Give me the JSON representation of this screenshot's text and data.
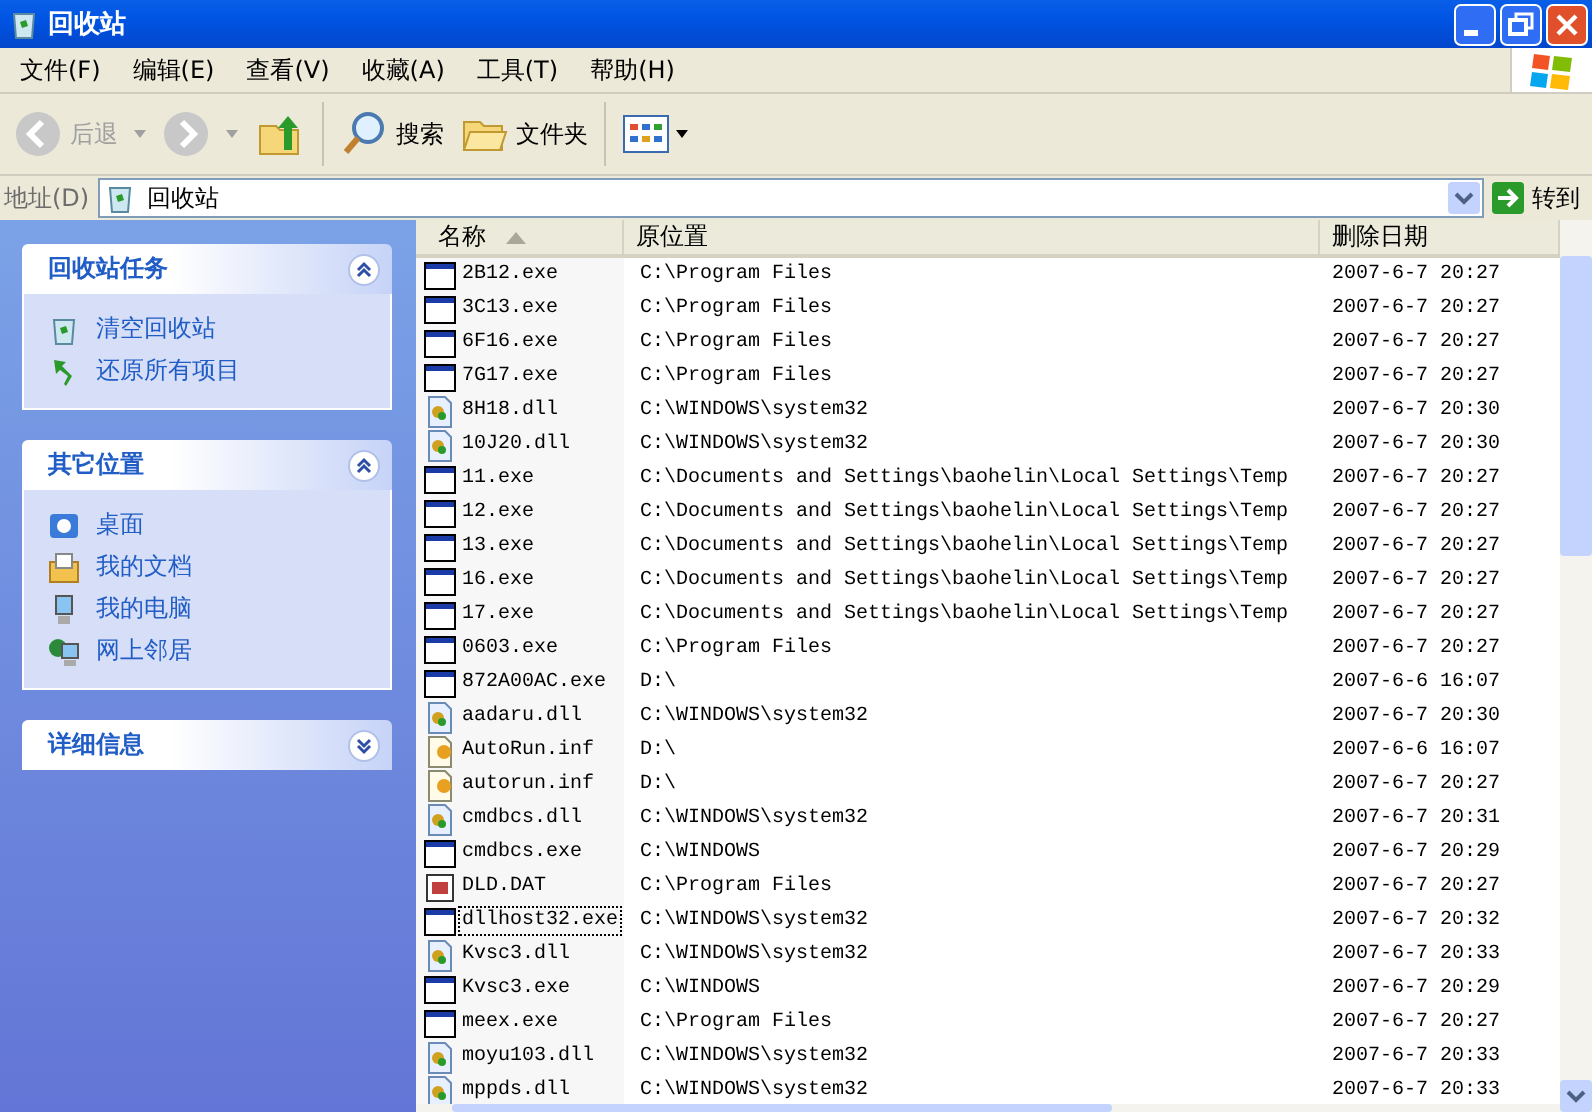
{
  "window": {
    "title": "回收站"
  },
  "menu": [
    "文件(F)",
    "编辑(E)",
    "查看(V)",
    "收藏(A)",
    "工具(T)",
    "帮助(H)"
  ],
  "toolbar": {
    "back": {
      "label": "后退",
      "disabled": true
    },
    "forward": {
      "disabled": true
    },
    "search": "搜索",
    "folders": "文件夹"
  },
  "address": {
    "label": "地址(D)",
    "value": "回收站",
    "go": "转到"
  },
  "task_panes": [
    {
      "title": "回收站任务",
      "expanded": true,
      "items": [
        {
          "label": "清空回收站",
          "kind": "bin"
        },
        {
          "label": "还原所有项目",
          "kind": "restore"
        }
      ]
    },
    {
      "title": "其它位置",
      "expanded": true,
      "items": [
        {
          "label": "桌面",
          "kind": "desktop"
        },
        {
          "label": "我的文档",
          "kind": "documents"
        },
        {
          "label": "我的电脑",
          "kind": "computer"
        },
        {
          "label": "网上邻居",
          "kind": "network"
        }
      ]
    },
    {
      "title": "详细信息",
      "expanded": false
    }
  ],
  "table": {
    "columns": [
      "名称",
      "原位置",
      "删除日期"
    ],
    "rows": [
      {
        "name": "2B12.exe",
        "location": "C:\\Program Files",
        "date": "2007-6-7 20:27",
        "kind": "exe",
        "focused": false
      },
      {
        "name": "3C13.exe",
        "location": "C:\\Program Files",
        "date": "2007-6-7 20:27",
        "kind": "exe",
        "focused": false
      },
      {
        "name": "6F16.exe",
        "location": "C:\\Program Files",
        "date": "2007-6-7 20:27",
        "kind": "exe",
        "focused": false
      },
      {
        "name": "7G17.exe",
        "location": "C:\\Program Files",
        "date": "2007-6-7 20:27",
        "kind": "exe",
        "focused": false
      },
      {
        "name": "8H18.dll",
        "location": "C:\\WINDOWS\\system32",
        "date": "2007-6-7 20:30",
        "kind": "dll",
        "focused": false
      },
      {
        "name": "10J20.dll",
        "location": "C:\\WINDOWS\\system32",
        "date": "2007-6-7 20:30",
        "kind": "dll",
        "focused": false
      },
      {
        "name": "11.exe",
        "location": "C:\\Documents and Settings\\baohelin\\Local Settings\\Temp",
        "date": "2007-6-7 20:27",
        "kind": "exe",
        "focused": false
      },
      {
        "name": "12.exe",
        "location": "C:\\Documents and Settings\\baohelin\\Local Settings\\Temp",
        "date": "2007-6-7 20:27",
        "kind": "exe",
        "focused": false
      },
      {
        "name": "13.exe",
        "location": "C:\\Documents and Settings\\baohelin\\Local Settings\\Temp",
        "date": "2007-6-7 20:27",
        "kind": "exe",
        "focused": false
      },
      {
        "name": "16.exe",
        "location": "C:\\Documents and Settings\\baohelin\\Local Settings\\Temp",
        "date": "2007-6-7 20:27",
        "kind": "exe",
        "focused": false
      },
      {
        "name": "17.exe",
        "location": "C:\\Documents and Settings\\baohelin\\Local Settings\\Temp",
        "date": "2007-6-7 20:27",
        "kind": "exe",
        "focused": false
      },
      {
        "name": "0603.exe",
        "location": "C:\\Program Files",
        "date": "2007-6-7 20:27",
        "kind": "exe",
        "focused": false
      },
      {
        "name": "872A00AC.exe",
        "location": "D:\\",
        "date": "2007-6-6 16:07",
        "kind": "exe",
        "focused": false
      },
      {
        "name": "aadaru.dll",
        "location": "C:\\WINDOWS\\system32",
        "date": "2007-6-7 20:30",
        "kind": "dll",
        "focused": false
      },
      {
        "name": "AutoRun.inf",
        "location": "D:\\",
        "date": "2007-6-6 16:07",
        "kind": "inf",
        "focused": false
      },
      {
        "name": "autorun.inf",
        "location": "D:\\",
        "date": "2007-6-7 20:27",
        "kind": "inf",
        "focused": false
      },
      {
        "name": "cmdbcs.dll",
        "location": "C:\\WINDOWS\\system32",
        "date": "2007-6-7 20:31",
        "kind": "dll",
        "focused": false
      },
      {
        "name": "cmdbcs.exe",
        "location": "C:\\WINDOWS",
        "date": "2007-6-7 20:29",
        "kind": "exe",
        "focused": false
      },
      {
        "name": "DLD.DAT",
        "location": "C:\\Program Files",
        "date": "2007-6-7 20:27",
        "kind": "dat",
        "focused": false
      },
      {
        "name": "dllhost32.exe",
        "location": "C:\\WINDOWS\\system32",
        "date": "2007-6-7 20:32",
        "kind": "exe",
        "focused": true
      },
      {
        "name": "Kvsc3.dll",
        "location": "C:\\WINDOWS\\system32",
        "date": "2007-6-7 20:33",
        "kind": "dll",
        "focused": false
      },
      {
        "name": "Kvsc3.exe",
        "location": "C:\\WINDOWS",
        "date": "2007-6-7 20:29",
        "kind": "exe",
        "focused": false
      },
      {
        "name": "meex.exe",
        "location": "C:\\Program Files",
        "date": "2007-6-7 20:27",
        "kind": "exe",
        "focused": false
      },
      {
        "name": "moyu103.dll",
        "location": "C:\\WINDOWS\\system32",
        "date": "2007-6-7 20:33",
        "kind": "dll",
        "focused": false
      },
      {
        "name": "mppds.dll",
        "location": "C:\\WINDOWS\\system32",
        "date": "2007-6-7 20:33",
        "kind": "dll",
        "focused": false
      }
    ]
  }
}
